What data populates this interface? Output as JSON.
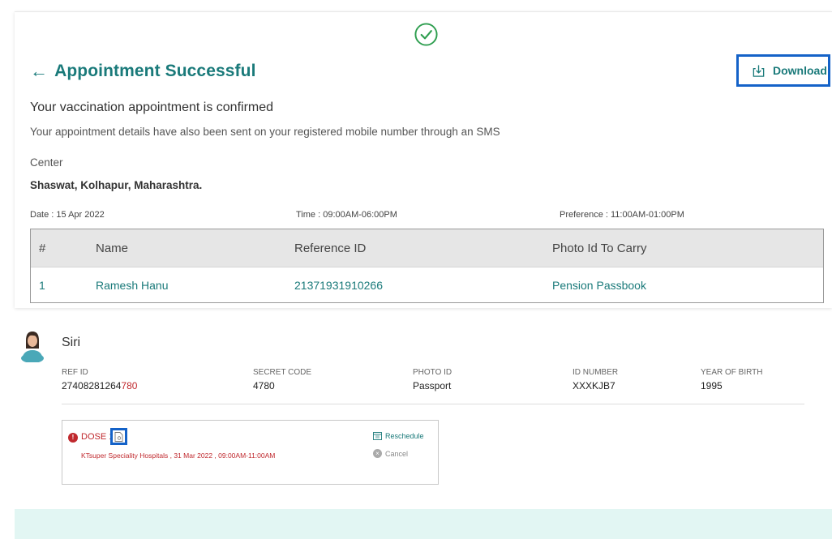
{
  "header": {
    "title": "Appointment Successful",
    "download_label": "Download"
  },
  "confirmation": {
    "heading": "Your vaccination appointment is confirmed",
    "sms_note": "Your appointment details have also been sent on your registered mobile number through an SMS",
    "center_label": "Center",
    "center_value": "Shaswat, Kolhapur, Maharashtra."
  },
  "meta": {
    "date": "Date : 15 Apr 2022",
    "time": "Time : 09:00AM-06:00PM",
    "preference": "Preference : 11:00AM-01:00PM"
  },
  "table": {
    "headers": [
      "#",
      "Name",
      "Reference ID",
      "Photo Id To Carry"
    ],
    "rows": [
      [
        "1",
        "Ramesh Hanu",
        "21371931910266",
        "Pension Passbook"
      ]
    ]
  },
  "beneficiary": {
    "name": "Siri",
    "ref_id_label": "REF ID",
    "ref_id_prefix": "27408281264",
    "ref_id_suffix": "780",
    "secret_code_label": "SECRET CODE",
    "secret_code": "4780",
    "photo_id_label": "PHOTO ID",
    "photo_id": "Passport",
    "id_number_label": "ID NUMBER",
    "id_number": "XXXKJB7",
    "yob_label": "YEAR OF BIRTH",
    "yob": "1995"
  },
  "dose": {
    "label": "DOSE 1",
    "detail": "KTsuper Speciality Hospitals , 31 Mar 2022 , 09:00AM-11:00AM",
    "reschedule_label": "Reschedule",
    "cancel_label": "Cancel"
  },
  "colors": {
    "brand": "#1a7a7a",
    "highlight": "#1462c8",
    "alert": "#c0292e",
    "band": "#e2f6f3"
  }
}
